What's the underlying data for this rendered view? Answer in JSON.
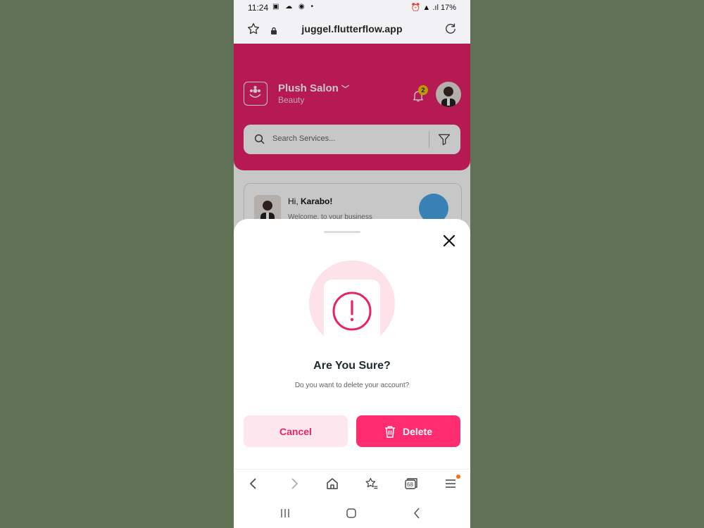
{
  "status_bar": {
    "time": "11:24",
    "battery": "17%"
  },
  "browser": {
    "url": "juggel.flutterflow.app",
    "tab_count": "68"
  },
  "app": {
    "business_name": "Plush Salon",
    "business_category": "Beauty",
    "notification_count": "2",
    "search_placeholder": "Search Services...",
    "greeting_prefix": "Hi,",
    "greeting_name": "Karabo!",
    "welcome_text": "Welcome, to your business"
  },
  "dialog": {
    "title": "Are You Sure?",
    "message": "Do you want to delete your account?",
    "cancel_label": "Cancel",
    "delete_label": "Delete"
  },
  "colors": {
    "brand": "#e8226a",
    "delete": "#ff2c6f",
    "cancel_bg": "#fde6ee",
    "backdrop": "#617155"
  }
}
